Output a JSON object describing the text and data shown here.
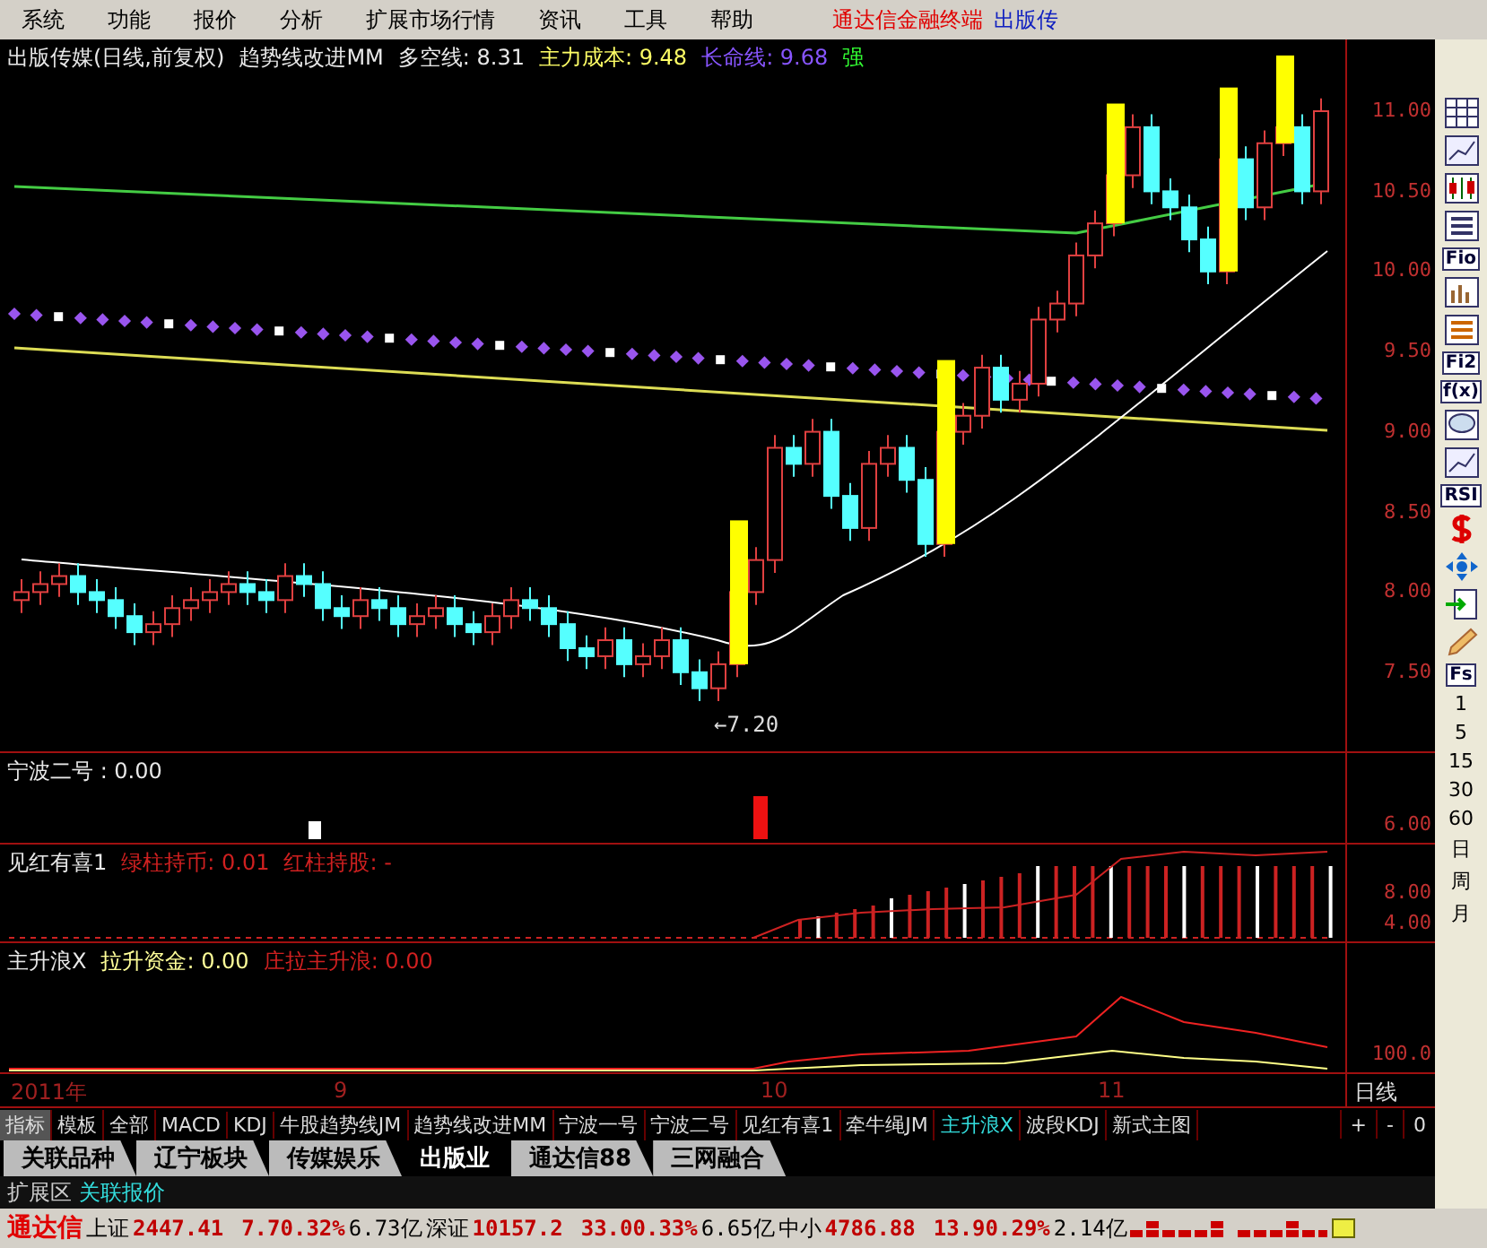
{
  "menu": {
    "items": [
      "系统",
      "功能",
      "报价",
      "分析",
      "扩展市场行情",
      "资讯",
      "工具",
      "帮助"
    ],
    "brand": "通达信金融终端",
    "stock_name_cut": "出版传"
  },
  "main_panel": {
    "header": [
      {
        "text": "出版传媒(日线,前复权)",
        "color": "#e8e8e8"
      },
      {
        "text": "趋势线改进MM",
        "color": "#e8e8e8"
      },
      {
        "text": "多空线: 8.31",
        "color": "#e8e8e8"
      },
      {
        "text": "主力成本: 9.48",
        "color": "#ffff66"
      },
      {
        "text": "长命线: 9.68",
        "color": "#8855ff"
      },
      {
        "text": "强",
        "color": "#33ff33"
      }
    ],
    "low_label": "←7.20",
    "axis": [
      "11.00",
      "10.50",
      "10.00",
      "9.50",
      "9.00",
      "8.50",
      "8.00",
      "7.50"
    ]
  },
  "sub_panels": [
    {
      "kind": "spikes",
      "header": [
        {
          "text": "宁波二号 : 0.00",
          "color": "#e8e8e8"
        }
      ],
      "axis": [
        "6.00"
      ]
    },
    {
      "kind": "bars",
      "header": [
        {
          "text": "见红有喜1",
          "color": "#e8e8e8"
        },
        {
          "text": "绿柱持币: 0.01",
          "color": "#d02020"
        },
        {
          "text": "红柱持股: -",
          "color": "#d02020"
        }
      ],
      "axis": [
        "8.00",
        "4.00"
      ]
    },
    {
      "kind": "lines",
      "header": [
        {
          "text": "主升浪X",
          "color": "#e8e8e8"
        },
        {
          "text": "拉升资金: 0.00",
          "color": "#ffff99"
        },
        {
          "text": "庄拉主升浪: 0.00",
          "color": "#d02020"
        }
      ],
      "axis": [
        "100.0"
      ]
    }
  ],
  "date_axis": {
    "labels": [
      "2011年",
      "9",
      "10",
      "11"
    ],
    "period": "日线"
  },
  "indicator_tabs": [
    {
      "label": "指标",
      "selected": true
    },
    {
      "label": "模板",
      "selected": false
    },
    {
      "label": "全部",
      "selected": false
    },
    {
      "label": "MACD",
      "selected": false
    },
    {
      "label": "KDJ",
      "selected": false
    },
    {
      "label": "牛股趋势线JM",
      "selected": false
    },
    {
      "label": "趋势线改进MM",
      "selected": false
    },
    {
      "label": "宁波一号",
      "selected": false
    },
    {
      "label": "宁波二号",
      "selected": false
    },
    {
      "label": "见红有喜1",
      "selected": false
    },
    {
      "label": "牵牛绳JM",
      "selected": false
    },
    {
      "label": "主升浪X",
      "selected": true
    },
    {
      "label": "波段KDJ",
      "selected": false
    },
    {
      "label": "新式主图",
      "selected": false
    }
  ],
  "zoom_buttons": [
    "+",
    "-",
    "0"
  ],
  "sector_tabs": [
    {
      "label": "关联品种",
      "selected": false
    },
    {
      "label": "辽宁板块",
      "selected": false
    },
    {
      "label": "传媒娱乐",
      "selected": false
    },
    {
      "label": "出版业",
      "selected": true
    },
    {
      "label": "通达信88",
      "selected": false
    },
    {
      "label": "三网融合",
      "selected": false
    }
  ],
  "extension_tabs": [
    {
      "label": "扩展区",
      "selected": false
    },
    {
      "label": "关联报价",
      "selected": true
    }
  ],
  "toolbar": [
    {
      "kind": "grid"
    },
    {
      "kind": "line"
    },
    {
      "kind": "candles"
    },
    {
      "kind": "list"
    },
    {
      "kind": "text",
      "text": "Fio"
    },
    {
      "kind": "bars"
    },
    {
      "kind": "list2"
    },
    {
      "kind": "text",
      "text": "Fi2"
    },
    {
      "kind": "text",
      "text": "f(x)"
    },
    {
      "kind": "bubble"
    },
    {
      "kind": "line"
    },
    {
      "kind": "text",
      "text": "RSI"
    },
    {
      "kind": "dollar"
    },
    {
      "kind": "move"
    },
    {
      "kind": "import"
    },
    {
      "kind": "pencil"
    },
    {
      "kind": "text",
      "text": "Fs"
    },
    {
      "kind": "period",
      "text": "1"
    },
    {
      "kind": "period",
      "text": "5"
    },
    {
      "kind": "period",
      "text": "15"
    },
    {
      "kind": "period",
      "text": "30"
    },
    {
      "kind": "period",
      "text": "60"
    },
    {
      "kind": "period",
      "text": "日"
    },
    {
      "kind": "period",
      "text": "周"
    },
    {
      "kind": "period",
      "text": "月"
    }
  ],
  "status_bar": {
    "brand": "通达信",
    "indices": [
      {
        "name": "上证",
        "value": "2447.41",
        "change": "7.70.32%",
        "amount": "6.73亿"
      },
      {
        "name": "深证",
        "value": "10157.2",
        "change": "33.00.33%",
        "amount": "6.65亿"
      },
      {
        "name": "中小",
        "value": "4786.88",
        "change": "13.90.29%",
        "amount": "2.14亿"
      }
    ]
  }
}
